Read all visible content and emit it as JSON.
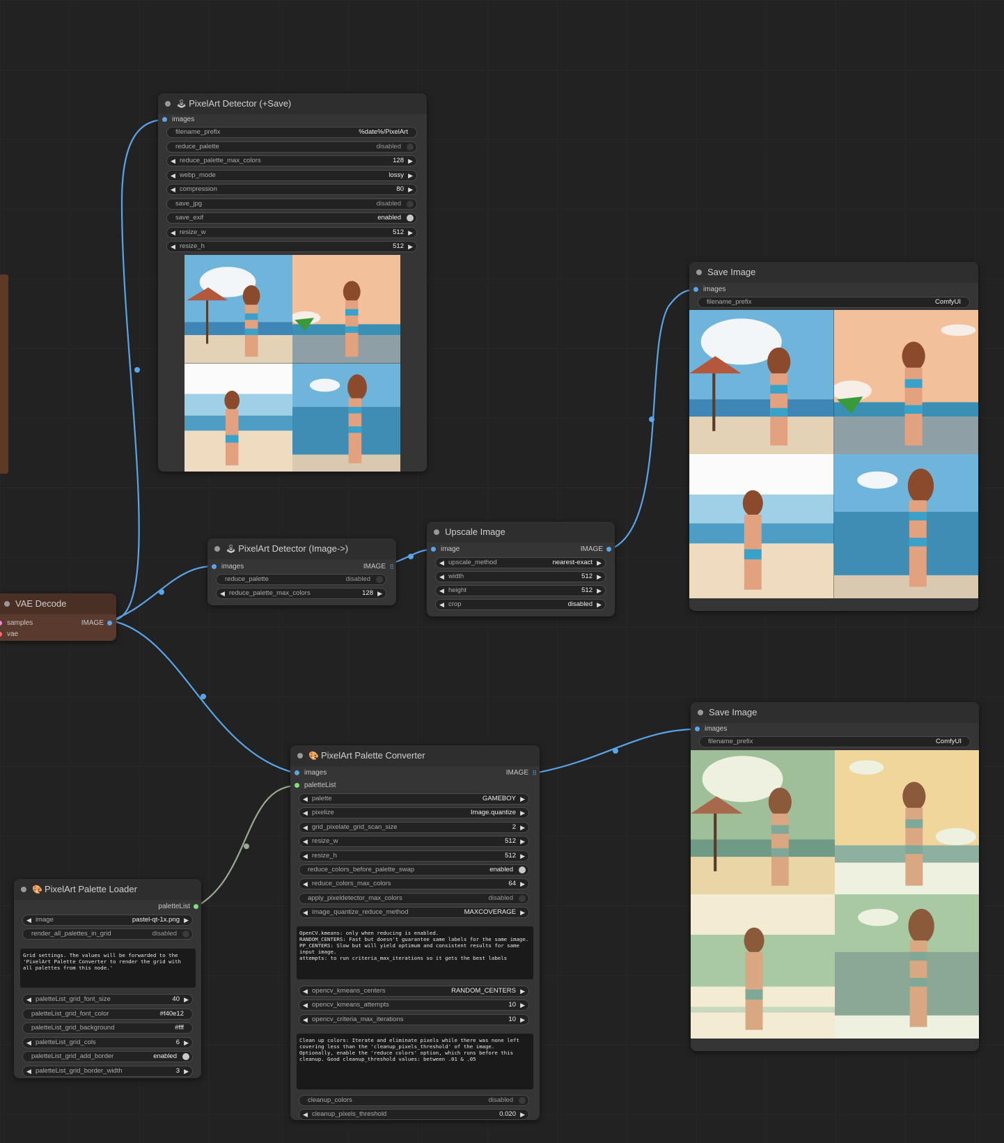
{
  "colors": {
    "canvas": "#222222",
    "node": "#353535",
    "vae_node": "#5a3a2e",
    "link_image": "#5aa5e8",
    "link_palette": "#9aaa94",
    "slot_latent": "#f08ad6",
    "slot_vae": "#ff6e6e",
    "slot_palette": "#7ee07e"
  },
  "vae_decode": {
    "title": "VAE Decode",
    "inputs": [
      "samples",
      "vae"
    ],
    "output": "IMAGE"
  },
  "detector_save": {
    "icon": "joystick-icon",
    "title": "PixelArt Detector (+Save)",
    "input": "images",
    "widgets": [
      {
        "label": "filename_prefix",
        "value": "%date%/PixelArt"
      },
      {
        "label": "reduce_palette",
        "value": "disabled"
      },
      {
        "label": "reduce_palette_max_colors",
        "value": "128"
      },
      {
        "label": "webp_mode",
        "value": "lossy"
      },
      {
        "label": "compression",
        "value": "80"
      },
      {
        "label": "save_jpg",
        "value": "disabled"
      },
      {
        "label": "save_exif",
        "value": "enabled"
      },
      {
        "label": "resize_w",
        "value": "512"
      },
      {
        "label": "resize_h",
        "value": "512"
      }
    ]
  },
  "detector_image": {
    "icon": "joystick-icon",
    "title": "PixelArt Detector (Image->)",
    "input": "images",
    "output": "IMAGE",
    "widgets": [
      {
        "label": "reduce_palette",
        "value": "disabled"
      },
      {
        "label": "reduce_palette_max_colors",
        "value": "128"
      }
    ]
  },
  "upscale": {
    "title": "Upscale Image",
    "input": "image",
    "output": "IMAGE",
    "widgets": [
      {
        "label": "upscale_method",
        "value": "nearest-exact"
      },
      {
        "label": "width",
        "value": "512"
      },
      {
        "label": "height",
        "value": "512"
      },
      {
        "label": "crop",
        "value": "disabled"
      }
    ]
  },
  "save1": {
    "title": "Save Image",
    "input": "images",
    "widgets": [
      {
        "label": "filename_prefix",
        "value": "ComfyUI"
      }
    ]
  },
  "save2": {
    "title": "Save Image",
    "input": "images",
    "widgets": [
      {
        "label": "filename_prefix",
        "value": "ComfyUI"
      }
    ]
  },
  "converter": {
    "icon": "palette-icon",
    "title": "PixelArt Palette Converter",
    "inputs": [
      "images",
      "paletteList"
    ],
    "output": "IMAGE",
    "widgets_a": [
      {
        "label": "palette",
        "value": "GAMEBOY"
      },
      {
        "label": "pixelize",
        "value": "Image.quantize"
      },
      {
        "label": "grid_pixelate_grid_scan_size",
        "value": "2"
      },
      {
        "label": "resize_w",
        "value": "512"
      },
      {
        "label": "resize_h",
        "value": "512"
      },
      {
        "label": "reduce_colors_before_palette_swap",
        "value": "enabled"
      },
      {
        "label": "reduce_colors_max_colors",
        "value": "64"
      },
      {
        "label": "apply_pixeldetector_max_colors",
        "value": "disabled"
      },
      {
        "label": "image_quantize_reduce_method",
        "value": "MAXCOVERAGE"
      }
    ],
    "note1": "OpenCV.kmeans: only when reducing is enabled.\nRANDOM_CENTERS: Fast but doesn't guarantee same labels for the same image.\nPP_CENTERS: Slow but will yield optimum and consistent results for same input image.\nattempts: to run criteria_max_iterations so it gets the best labels",
    "widgets_b": [
      {
        "label": "opencv_kmeans_centers",
        "value": "RANDOM_CENTERS"
      },
      {
        "label": "opencv_kmeans_attempts",
        "value": "10"
      },
      {
        "label": "opencv_criteria_max_iterations",
        "value": "10"
      }
    ],
    "note2": "Clean up colors: Iterate and eliminate pixels while there was none left covering less than the 'cleanup_pixels_threshold' of the image.\nOptionally, enable the 'reduce colors' option, which runs before this cleanup. Good cleanup_threshold values: between .01 & .05",
    "widgets_c": [
      {
        "label": "cleanup_colors",
        "value": "disabled"
      },
      {
        "label": "cleanup_pixels_threshold",
        "value": "0.020"
      }
    ]
  },
  "loader": {
    "icon": "palette-icon",
    "title": "PixelArt Palette Loader",
    "output": "paletteList",
    "widgets_a": [
      {
        "label": "image",
        "value": "pastel-qt-1x.png"
      },
      {
        "label": "render_all_palettes_in_grid",
        "value": "disabled"
      }
    ],
    "note": "Grid settings. The values will be forwarded to the 'PixelArt Palette Converter to render the grid with all palettes from this node.'",
    "widgets_b": [
      {
        "label": "paletteList_grid_font_size",
        "value": "40"
      },
      {
        "label": "paletteList_grid_font_color",
        "value": "#f40e12"
      },
      {
        "label": "paletteList_grid_background",
        "value": "#fff"
      },
      {
        "label": "paletteList_grid_cols",
        "value": "6"
      },
      {
        "label": "paletteList_grid_add_border",
        "value": "enabled"
      },
      {
        "label": "paletteList_grid_border_width",
        "value": "3"
      }
    ]
  }
}
